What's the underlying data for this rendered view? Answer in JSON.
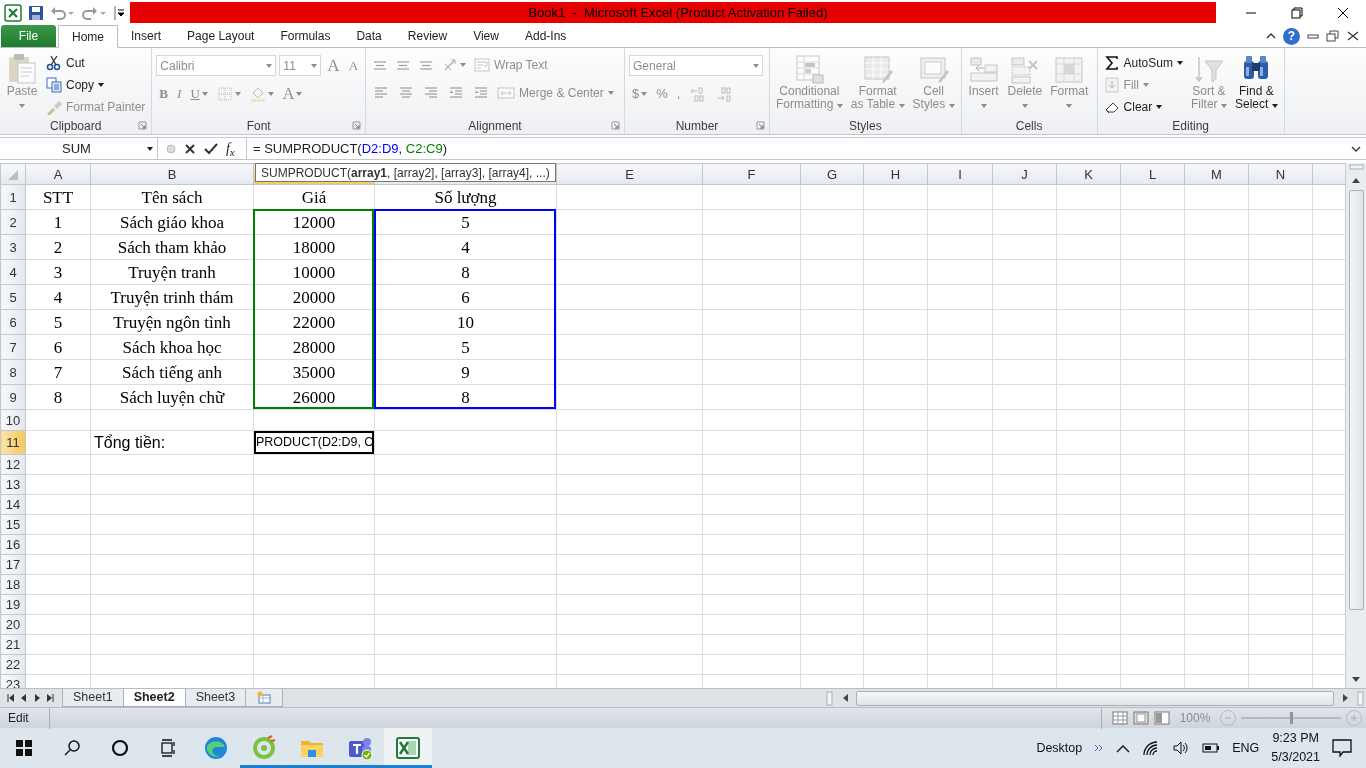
{
  "title_bar": {
    "title": "Book1  -  Microsoft Excel (Product Activation Failed)"
  },
  "ribbon_tabs": [
    {
      "label": "File",
      "kind": "file",
      "selected": false
    },
    {
      "label": "Home",
      "kind": "tab",
      "selected": true
    },
    {
      "label": "Insert",
      "kind": "tab",
      "selected": false
    },
    {
      "label": "Page Layout",
      "kind": "tab",
      "selected": false
    },
    {
      "label": "Formulas",
      "kind": "tab",
      "selected": false
    },
    {
      "label": "Data",
      "kind": "tab",
      "selected": false
    },
    {
      "label": "Review",
      "kind": "tab",
      "selected": false
    },
    {
      "label": "View",
      "kind": "tab",
      "selected": false
    },
    {
      "label": "Add-Ins",
      "kind": "tab",
      "selected": false
    }
  ],
  "help_label": "?",
  "ribbon_groups": [
    {
      "label": "Clipboard",
      "dialog_launcher": true,
      "sections": [
        {
          "kind": "large",
          "items": [
            {
              "kind": "large",
              "lines": [
                "Paste"
              ],
              "dropdown": true,
              "disabled": true
            }
          ]
        },
        {
          "kind": "stack",
          "items": [
            {
              "kind": "button",
              "label": "Cut",
              "dropdown": false,
              "disabled": false
            },
            {
              "kind": "button",
              "label": "Copy",
              "dropdown": true,
              "disabled": false
            },
            {
              "kind": "button",
              "label": "Format Painter",
              "dropdown": false,
              "disabled": true
            }
          ]
        }
      ]
    },
    {
      "label": "Font",
      "dialog_launcher": true,
      "sections": [
        {
          "kind": "rows",
          "rows": [
            {
              "items": [
                {
                  "kind": "combo",
                  "value": "Calibri",
                  "disabled": true
                },
                {
                  "kind": "combo",
                  "value": "11",
                  "disabled": true
                },
                {
                  "kind": "glyph",
                  "label": "A",
                  "dropdown": false,
                  "disabled": true
                },
                {
                  "kind": "glyph",
                  "label": "A",
                  "dropdown": false,
                  "disabled": true
                }
              ]
            },
            {
              "items": [
                {
                  "kind": "glyph",
                  "label": "B",
                  "dropdown": false,
                  "disabled": true
                },
                {
                  "kind": "glyph",
                  "label": "I",
                  "dropdown": false,
                  "disabled": true
                },
                {
                  "kind": "glyph",
                  "label": "U",
                  "dropdown": true,
                  "disabled": true
                },
                {
                  "kind": "icon",
                  "dropdown": true,
                  "disabled": true
                },
                {
                  "kind": "icon",
                  "dropdown": true,
                  "disabled": true
                },
                {
                  "kind": "glyph",
                  "label": "A",
                  "dropdown": true,
                  "disabled": true
                }
              ]
            }
          ]
        }
      ]
    },
    {
      "label": "Alignment",
      "dialog_launcher": true,
      "sections": [
        {
          "kind": "rows",
          "rows": [
            {
              "items": [
                {
                  "kind": "icon",
                  "dropdown": false,
                  "disabled": true
                },
                {
                  "kind": "icon",
                  "dropdown": false,
                  "disabled": true
                },
                {
                  "kind": "icon",
                  "dropdown": false,
                  "disabled": true
                },
                {
                  "kind": "icon",
                  "dropdown": true,
                  "disabled": true
                },
                {
                  "kind": "button",
                  "label": "Wrap Text",
                  "dropdown": false,
                  "disabled": true
                }
              ]
            },
            {
              "items": [
                {
                  "kind": "icon",
                  "dropdown": false,
                  "disabled": true
                },
                {
                  "kind": "icon",
                  "dropdown": false,
                  "disabled": true
                },
                {
                  "kind": "icon",
                  "dropdown": false,
                  "disabled": true
                },
                {
                  "kind": "icon",
                  "dropdown": false,
                  "disabled": true
                },
                {
                  "kind": "icon",
                  "dropdown": false,
                  "disabled": true
                },
                {
                  "kind": "button",
                  "label": "Merge & Center",
                  "dropdown": true,
                  "disabled": true
                }
              ]
            }
          ]
        }
      ]
    },
    {
      "label": "Number",
      "dialog_launcher": true,
      "sections": [
        {
          "kind": "rows",
          "rows": [
            {
              "items": [
                {
                  "kind": "combo",
                  "value": "General",
                  "disabled": true
                }
              ]
            },
            {
              "items": [
                {
                  "kind": "glyph",
                  "label": "$",
                  "dropdown": true,
                  "disabled": true
                },
                {
                  "kind": "glyph",
                  "label": "%",
                  "dropdown": false,
                  "disabled": true
                },
                {
                  "kind": "glyph",
                  "label": ",",
                  "dropdown": false,
                  "disabled": true
                },
                {
                  "kind": "icon",
                  "dropdown": false,
                  "disabled": true
                },
                {
                  "kind": "icon",
                  "dropdown": false,
                  "disabled": true
                }
              ]
            }
          ]
        }
      ]
    },
    {
      "label": "Styles",
      "dialog_launcher": false,
      "sections": [
        {
          "kind": "large",
          "items": [
            {
              "kind": "large",
              "lines": [
                "Conditional",
                "Formatting"
              ],
              "dropdown": true,
              "disabled": true
            },
            {
              "kind": "large",
              "lines": [
                "Format",
                "as Table"
              ],
              "dropdown": true,
              "disabled": true
            },
            {
              "kind": "large",
              "lines": [
                "Cell",
                "Styles"
              ],
              "dropdown": true,
              "disabled": true
            }
          ]
        }
      ]
    },
    {
      "label": "Cells",
      "dialog_launcher": false,
      "sections": [
        {
          "kind": "large",
          "items": [
            {
              "kind": "large",
              "lines": [
                "Insert"
              ],
              "dropdown": true,
              "disabled": true
            },
            {
              "kind": "large",
              "lines": [
                "Delete"
              ],
              "dropdown": true,
              "disabled": true
            },
            {
              "kind": "large",
              "lines": [
                "Format"
              ],
              "dropdown": true,
              "disabled": true
            }
          ]
        }
      ]
    },
    {
      "label": "Editing",
      "dialog_launcher": false,
      "sections": [
        {
          "kind": "stack",
          "items": [
            {
              "kind": "button",
              "label": "AutoSum",
              "dropdown": true,
              "disabled": false
            },
            {
              "kind": "button",
              "label": "Fill",
              "dropdown": true,
              "disabled": true
            },
            {
              "kind": "button",
              "label": "Clear",
              "dropdown": true,
              "disabled": false
            }
          ]
        },
        {
          "kind": "large",
          "items": [
            {
              "kind": "large",
              "lines": [
                "Sort &",
                "Filter"
              ],
              "dropdown": true,
              "disabled": true
            },
            {
              "kind": "large",
              "lines": [
                "Find &",
                "Select"
              ],
              "dropdown": true,
              "disabled": false
            }
          ]
        }
      ]
    }
  ],
  "formula_bar": {
    "name_box": "SUM",
    "fx_label": "f$_{x}$",
    "formula": [
      {
        "text": "= SUMPRODUCT(",
        "kind": "text"
      },
      {
        "text": "D2:D9",
        "kind": "ref",
        "color": "#0000ff"
      },
      {
        "text": ", ",
        "kind": "text"
      },
      {
        "text": "C2:C9",
        "kind": "ref",
        "color": "#008000"
      },
      {
        "text": ")",
        "kind": "text"
      }
    ]
  },
  "sheet": {
    "tooltip": "SUMPRODUCT(**array1**, [array2], [array3], [array4], ...)",
    "columns": [
      {
        "label": "A",
        "selected": false
      },
      {
        "label": "B",
        "selected": false
      },
      {
        "selected": true
      },
      {
        "selected": false
      },
      {
        "label": "E",
        "selected": false
      },
      {
        "label": "F",
        "selected": false
      },
      {
        "label": "G",
        "selected": false
      },
      {
        "label": "H",
        "selected": false
      },
      {
        "label": "I",
        "selected": false
      },
      {
        "label": "J",
        "selected": false
      },
      {
        "label": "K",
        "selected": false
      },
      {
        "label": "L",
        "selected": false
      },
      {
        "label": "M",
        "selected": false
      },
      {
        "label": "N",
        "selected": false
      }
    ],
    "rows": [
      {
        "label": "1",
        "selected": false,
        "cells": [
          {
            "text": "STT",
            "kind": "serif"
          },
          {
            "text": "Tên sách",
            "kind": "serif"
          },
          {
            "text": "Giá",
            "kind": "serif"
          },
          {
            "text": "Số lượng",
            "kind": "serif"
          }
        ]
      },
      {
        "label": "2",
        "selected": false,
        "cells": [
          {
            "text": "1",
            "kind": "serif"
          },
          {
            "text": "Sách giáo khoa",
            "kind": "serif"
          },
          {
            "text": "12000",
            "kind": "serif",
            "color": "#008000"
          },
          {
            "text": "5",
            "kind": "serif",
            "color": "#0000ff"
          }
        ]
      },
      {
        "label": "3",
        "selected": false,
        "cells": [
          {
            "text": "2",
            "kind": "serif"
          },
          {
            "text": "Sách tham khảo",
            "kind": "serif"
          },
          {
            "text": "18000",
            "kind": "serif",
            "color": "#008000"
          },
          {
            "text": "4",
            "kind": "serif",
            "color": "#0000ff"
          }
        ]
      },
      {
        "label": "4",
        "selected": false,
        "cells": [
          {
            "text": "3",
            "kind": "serif"
          },
          {
            "text": "Truyện tranh",
            "kind": "serif"
          },
          {
            "text": "10000",
            "kind": "serif",
            "color": "#008000"
          },
          {
            "text": "8",
            "kind": "serif",
            "color": "#0000ff"
          }
        ]
      },
      {
        "label": "5",
        "selected": false,
        "cells": [
          {
            "text": "4",
            "kind": "serif"
          },
          {
            "text": "Truyện trinh thám",
            "kind": "serif"
          },
          {
            "text": "20000",
            "kind": "serif",
            "color": "#008000"
          },
          {
            "text": "6",
            "kind": "serif",
            "color": "#0000ff"
          }
        ]
      },
      {
        "label": "6",
        "selected": false,
        "cells": [
          {
            "text": "5",
            "kind": "serif"
          },
          {
            "text": "Truyện ngôn tình",
            "kind": "serif"
          },
          {
            "text": "22000",
            "kind": "serif",
            "color": "#008000"
          },
          {
            "text": "10",
            "kind": "serif",
            "color": "#0000ff"
          }
        ]
      },
      {
        "label": "7",
        "selected": false,
        "cells": [
          {
            "text": "6",
            "kind": "serif"
          },
          {
            "text": "Sách khoa học",
            "kind": "serif"
          },
          {
            "text": "28000",
            "kind": "serif",
            "color": "#008000"
          },
          {
            "text": "5",
            "kind": "serif",
            "color": "#0000ff"
          }
        ]
      },
      {
        "label": "8",
        "selected": false,
        "cells": [
          {
            "text": "7",
            "kind": "serif"
          },
          {
            "text": "Sách tiếng anh",
            "kind": "serif"
          },
          {
            "text": "35000",
            "kind": "serif",
            "color": "#008000"
          },
          {
            "text": "9",
            "kind": "serif",
            "color": "#0000ff"
          }
        ]
      },
      {
        "label": "9",
        "selected": false,
        "cells": [
          {
            "text": "8",
            "kind": "serif"
          },
          {
            "text": "Sách luyện chữ",
            "kind": "serif"
          },
          {
            "text": "26000",
            "kind": "serif",
            "color": "#008000"
          },
          {
            "text": "8",
            "kind": "serif",
            "color": "#0000ff"
          }
        ]
      },
      {
        "label": "10",
        "selected": false
      },
      {
        "label": "11",
        "selected": true,
        "cells": [
          {
            "kind": "blank"
          },
          {
            "text": "Tổng tiền:",
            "kind": "label"
          },
          {
            "text": "PRODUCT(D2:D9, C",
            "kind": "editing"
          }
        ]
      },
      {
        "label": "12",
        "selected": false
      },
      {
        "label": "13",
        "selected": false
      },
      {
        "label": "14",
        "selected": false
      },
      {
        "label": "15",
        "selected": false
      },
      {
        "label": "16",
        "selected": false
      },
      {
        "label": "17",
        "selected": false
      },
      {
        "label": "18",
        "selected": false
      },
      {
        "label": "19",
        "selected": false
      },
      {
        "label": "20",
        "selected": false
      },
      {
        "label": "21",
        "selected": false
      },
      {
        "label": "22",
        "selected": false
      },
      {
        "label": "23",
        "selected": false
      }
    ]
  },
  "sheet_tabs": [
    {
      "label": "Sheet1",
      "selected": false
    },
    {
      "label": "Sheet2",
      "selected": true
    },
    {
      "label": "Sheet3",
      "selected": false
    }
  ],
  "status_bar": {
    "mode": "Edit",
    "zoom_label": "100%",
    "zoom": {
      "level": 0.5
    }
  },
  "taskbar": {
    "apps": [
      {
        "running": false,
        "selected": false
      },
      {
        "running": true,
        "selected": false
      },
      {
        "running": true,
        "selected": false
      },
      {
        "running": true,
        "selected": false
      },
      {
        "running": true,
        "selected": true
      }
    ],
    "desktop_label": "Desktop",
    "language": "ENG",
    "time": "9:23 PM",
    "date": "5/3/2021"
  }
}
